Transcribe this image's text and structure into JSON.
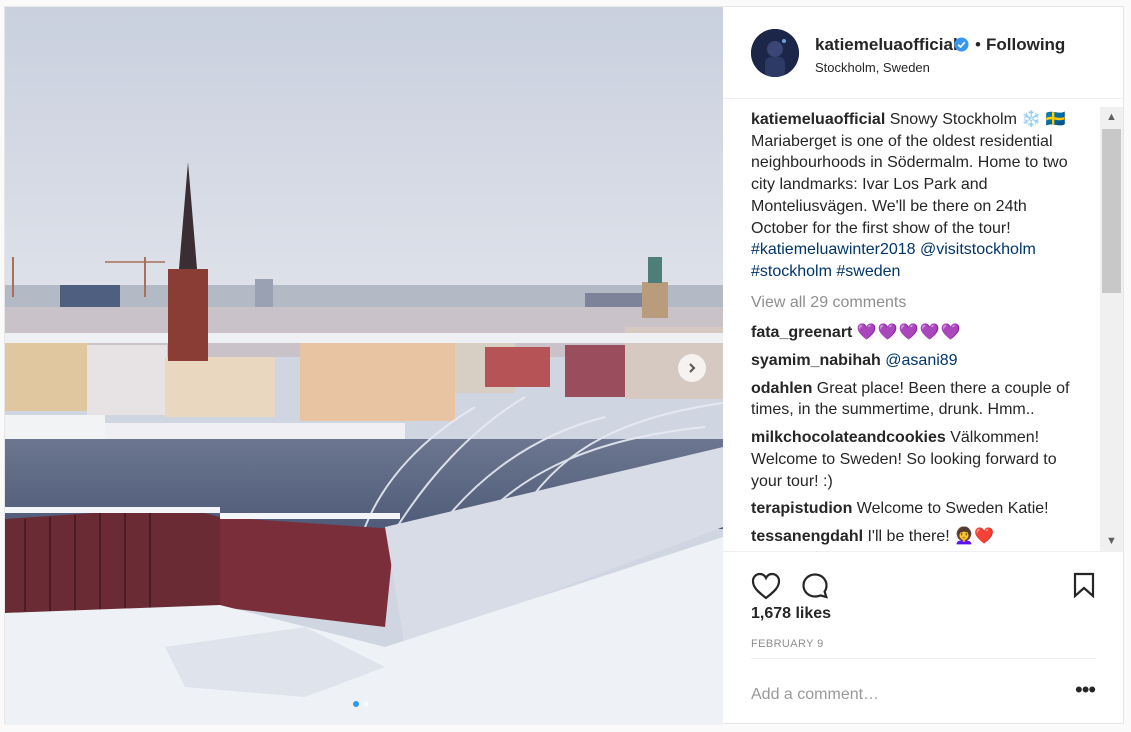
{
  "post": {
    "author": "katiemeluaofficial",
    "follow_status": "Following",
    "location": "Stockholm, Sweden",
    "caption": {
      "username": "katiemeluaofficial",
      "text": "Snowy Stockholm ❄️ 🇸🇪 Mariaberget is one of the oldest residential neighbourhoods in Södermalm. Home to two city landmarks: Ivar Los Park and Monteliusvägen. We'll be there on 24th October for the first show of the tour!",
      "hashtags": [
        "#katiemeluawinter2018",
        "@visitstockholm",
        "#stockholm",
        "#sweden"
      ]
    },
    "view_all_comments": "View all 29 comments",
    "comments": [
      {
        "username": "fata_greenart",
        "text": "💜💜💜💜💜"
      },
      {
        "username": "syamim_nabihah",
        "text": "@asani89"
      },
      {
        "username": "odahlen",
        "text": "Great place! Been there a couple of times, in the summertime, drunk. Hmm.."
      },
      {
        "username": "milkchocolateandcookies",
        "text": "Välkommen! Welcome to Sweden! So looking forward to your tour! :)"
      },
      {
        "username": "terapistudion",
        "text": "Welcome to Sweden Katie!"
      },
      {
        "username": "tessanengdahl",
        "text": "I'll be there! 👩‍🦱❤️"
      }
    ],
    "likes": "1,678 likes",
    "date": "FEBRUARY 9",
    "add_comment_placeholder": "Add a comment…",
    "more_label": "•••",
    "carousel": {
      "count": 2,
      "active_index": 0
    }
  },
  "icons": {
    "verified": "verified-badge-icon",
    "like": "heart-outline-icon",
    "comment": "speech-bubble-icon",
    "save": "bookmark-icon",
    "next": "chevron-right-icon",
    "more": "ellipsis-icon"
  },
  "colors": {
    "link": "#003569",
    "verified": "#3897f0",
    "muted": "#8e8e8e"
  }
}
